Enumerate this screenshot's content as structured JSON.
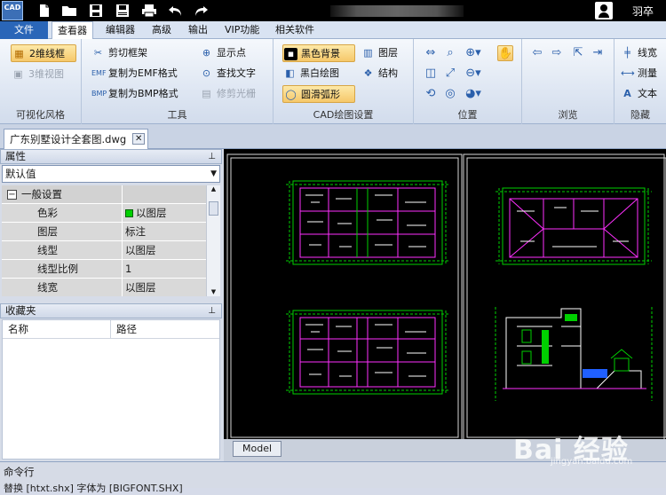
{
  "app": {
    "logo_text": "CAD",
    "user_name": "羽卒"
  },
  "quick_access": [
    "new-file-icon",
    "open-folder-icon",
    "save-icon",
    "save-as-icon",
    "print-icon",
    "undo-icon",
    "redo-icon"
  ],
  "menu": {
    "file": "文件",
    "viewer": "查看器",
    "editor": "编辑器",
    "advanced": "高级",
    "output": "输出",
    "vip": "VIP功能",
    "related": "相关软件"
  },
  "ribbon": {
    "visual": {
      "label": "可视化风格",
      "btn_2d": "2维线框",
      "btn_3d": "3维视图"
    },
    "tools": {
      "label": "工具",
      "clip_frame": "剪切框架",
      "copy_emf": "复制为EMF格式",
      "copy_bmp": "复制为BMP格式",
      "show_points": "显示点",
      "find_text": "查找文字",
      "trim_raster": "修剪光栅"
    },
    "cad_settings": {
      "label": "CAD绘图设置",
      "black_bg": "黑色背景",
      "bw_draw": "黑白绘图",
      "smooth_arc": "圆滑弧形",
      "layers": "图层",
      "structure": "结构"
    },
    "position": {
      "label": "位置"
    },
    "browse": {
      "label": "浏览"
    },
    "hide": {
      "label": "隐藏",
      "linewidth": "线宽",
      "measure": "测量",
      "text": "文本"
    }
  },
  "document": {
    "tab_title": "广东别墅设计全套图.dwg"
  },
  "properties": {
    "title": "属性",
    "dropdown": "默认值",
    "category": "一般设置",
    "rows": [
      {
        "name": "色彩",
        "value": "以图层"
      },
      {
        "name": "图层",
        "value": "标注"
      },
      {
        "name": "线型",
        "value": "以图层"
      },
      {
        "name": "线型比例",
        "value": "1"
      },
      {
        "name": "线宽",
        "value": "以图层"
      }
    ]
  },
  "favorites": {
    "title": "收藏夹",
    "col_name": "名称",
    "col_path": "路径"
  },
  "canvas": {
    "model_tab": "Model",
    "background": "#000000"
  },
  "command": {
    "label": "命令行",
    "text": "替换 [htxt.shx] 字体为 [BIGFONT.SHX]"
  },
  "watermark": {
    "text": "Bai 经验",
    "sub": "jingyan.baidu.com"
  }
}
